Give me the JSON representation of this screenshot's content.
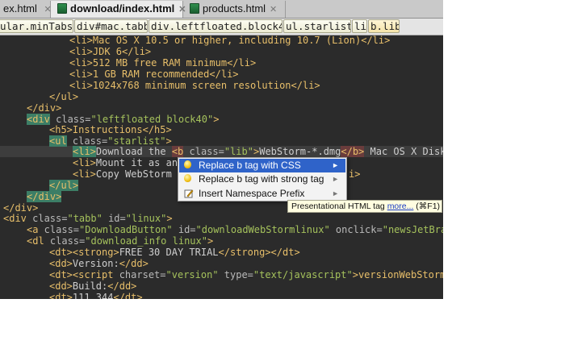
{
  "tabs": [
    {
      "label": "ex.html",
      "close": "✕"
    },
    {
      "label": "download/index.html",
      "close": "✕",
      "active": true
    },
    {
      "label": "products.html",
      "close": "✕"
    }
  ],
  "breadcrumbs": [
    "ular.minTabs",
    "div#mac.tabb",
    "div.leftfloated.block40",
    "ul.starlist",
    "li",
    "b.lib"
  ],
  "popup": {
    "items": [
      {
        "label": "Replace b tag with CSS",
        "icon": "lightbulb-icon",
        "arrow": "►"
      },
      {
        "label": "Replace b tag with strong tag",
        "icon": "lightbulb-icon",
        "arrow": "►"
      },
      {
        "label": "Insert Namespace Prefix",
        "icon": "edit-icon",
        "arrow": "►"
      }
    ]
  },
  "tooltip": {
    "text": "Presentational HTML tag",
    "link": "more...",
    "shortcut": "(⌘F1)"
  },
  "code": {
    "l1": "<li>Mac OS X 10.5 or higher, including 10.7 (Lion)</li>",
    "l2": "<li>JDK 6</li>",
    "l3": "<li>512 MB free RAM minimum</li>",
    "l4": "<li>1 GB RAM recommended</li>",
    "l5": "<li>1024x768 minimum screen resolution</li>",
    "l6": "</ul>",
    "l7": "</div>",
    "l8_tag": "<div",
    "l8_attr": " class=",
    "l8_val": "\"leftfloated block40\"",
    "l8_end": ">",
    "l9": "<h5>Instructions</h5>",
    "l10_tag": "<ul",
    "l10_attr": " class=",
    "l10_val": "\"starlist\"",
    "l10_end": ">",
    "l11_li": "<li>",
    "l11_text": "Download the ",
    "l11_b": "<b",
    "l11_attr": " class=",
    "l11_val": "\"lib\"",
    "l11_gt": ">",
    "l11_inner": "WebStorm-*.dmg",
    "l11_bclose": "</b>",
    "l11_rest": " Mac OS X Disk",
    "l12_li": "<li>",
    "l12_text": "Mount it as an",
    "l13_li": "<li>",
    "l13_text": "Copy WebStorm",
    "l13_tail": "i>",
    "l14": "</ul>",
    "l15": "</div>",
    "l16": "</div>",
    "l17_tag": "<div",
    "l17_attr1": " class=",
    "l17_val1": "\"tabb\"",
    "l17_attr2": " id=",
    "l17_val2": "\"linux\"",
    "l17_end": ">",
    "l18_tag": "<a",
    "l18_attr1": " class=",
    "l18_val1": "\"DownloadButton\"",
    "l18_attr2": " id=",
    "l18_val2": "\"downloadWebStormlinux\"",
    "l18_attr3": " onclick=",
    "l18_val3": "\"newsJetBra",
    "l19_tag": "<dl",
    "l19_attr": " class=",
    "l19_val": "\"download_info linux\"",
    "l19_end": ">",
    "l20_open": "<dt><strong>",
    "l20_text": "FREE 30 DAY TRIAL",
    "l20_close": "</strong></dt>",
    "l21_open": "<dd>",
    "l21_text": "Version:",
    "l21_close": "</dd>",
    "l22_tag": "<dt><script",
    "l22_attr1": " charset=",
    "l22_val1": "\"version\"",
    "l22_attr2": " type=",
    "l22_val2": "\"text/javascript\"",
    "l22_end": ">versionWebStorm",
    "l23_open": "<dd>",
    "l23_text": "Build:",
    "l23_close": "</dd>",
    "l24_open": "<dt>",
    "l24_text": "111.344",
    "l24_close": "</dt>"
  }
}
